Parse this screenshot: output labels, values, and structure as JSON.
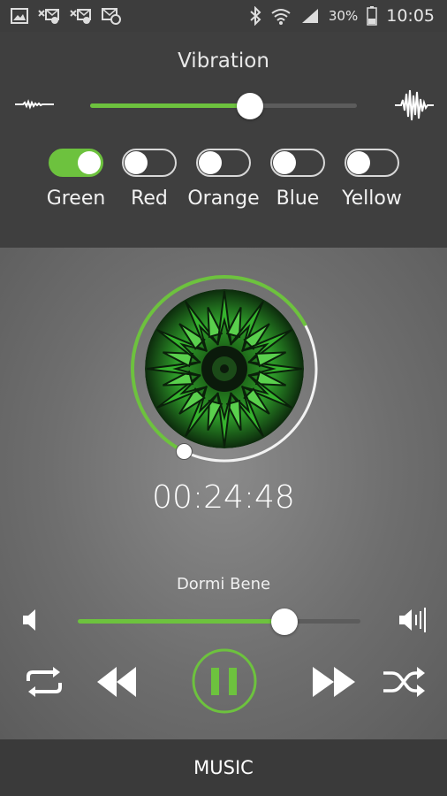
{
  "status_bar": {
    "battery_percent": "30%",
    "time": "10:05"
  },
  "vibration": {
    "title": "Vibration",
    "level": 0.6
  },
  "colors": [
    {
      "label": "Green",
      "on": true
    },
    {
      "label": "Red",
      "on": false
    },
    {
      "label": "Orange",
      "on": false
    },
    {
      "label": "Blue",
      "on": false
    },
    {
      "label": "Yellow",
      "on": false
    }
  ],
  "player": {
    "elapsed": "00:24:48",
    "track_title": "Dormi Bene",
    "progress_fraction": 0.6,
    "volume": 0.73,
    "state": "playing"
  },
  "bottom_tab": {
    "label": "MUSIC"
  },
  "theme": {
    "accent": "#6dc23e"
  }
}
